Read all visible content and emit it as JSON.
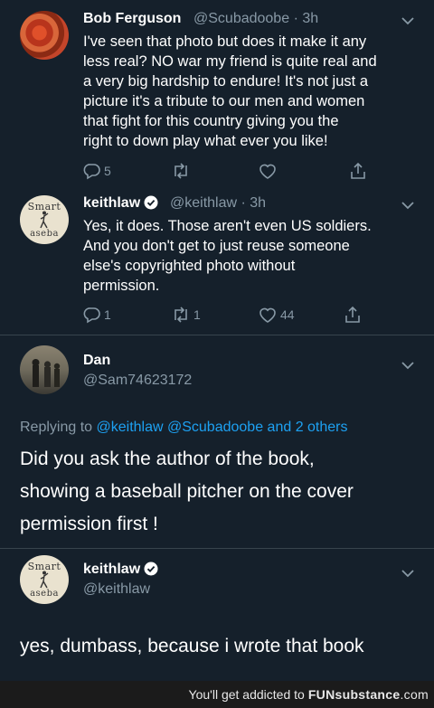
{
  "tweets": [
    {
      "name": "Bob Ferguson",
      "handle": "@Scubadoobe",
      "time": "· 3h",
      "lines": [
        "I've seen that photo but does it make it any",
        "less real? NO war my friend is quite real and",
        "a very big hardship to endure! It's not just a",
        "picture it's a tribute to our men and women",
        "that fight for this country giving you the",
        "right to down play what ever you like!"
      ],
      "reply_count": "5"
    },
    {
      "name": "keithlaw",
      "handle": "@keithlaw",
      "time": "· 3h",
      "lines": [
        "Yes, it does. Those aren't even US soldiers.",
        "And you don't get to just reuse someone",
        "else's copyrighted photo without",
        "permission."
      ],
      "reply_count": "1",
      "retweet_count": "1",
      "like_count": "44"
    }
  ],
  "avatar_book": {
    "top": "Smart",
    "bottom": "aseba"
  },
  "expanded": {
    "name": "Dan",
    "handle": "@Sam74623172",
    "replying_prefix": "Replying to",
    "replying_users": "@keithlaw @Scubadoobe",
    "replying_suffix": "and 2 others",
    "lines": [
      "Did you ask the author of the book,",
      "showing a baseball pitcher  on the cover",
      "permission first !"
    ]
  },
  "final": {
    "name": "keithlaw",
    "handle": "@keithlaw",
    "text": "yes, dumbass, because i wrote that book"
  },
  "footer": {
    "prefix": "You'll get addicted to",
    "brand": "FUN",
    "brand_sub": "substance",
    "brand_tld": ".com"
  },
  "colors": {
    "background": "#15202b",
    "muted": "#8899a6",
    "link": "#1da1f2",
    "verified": "#1da1f2"
  }
}
